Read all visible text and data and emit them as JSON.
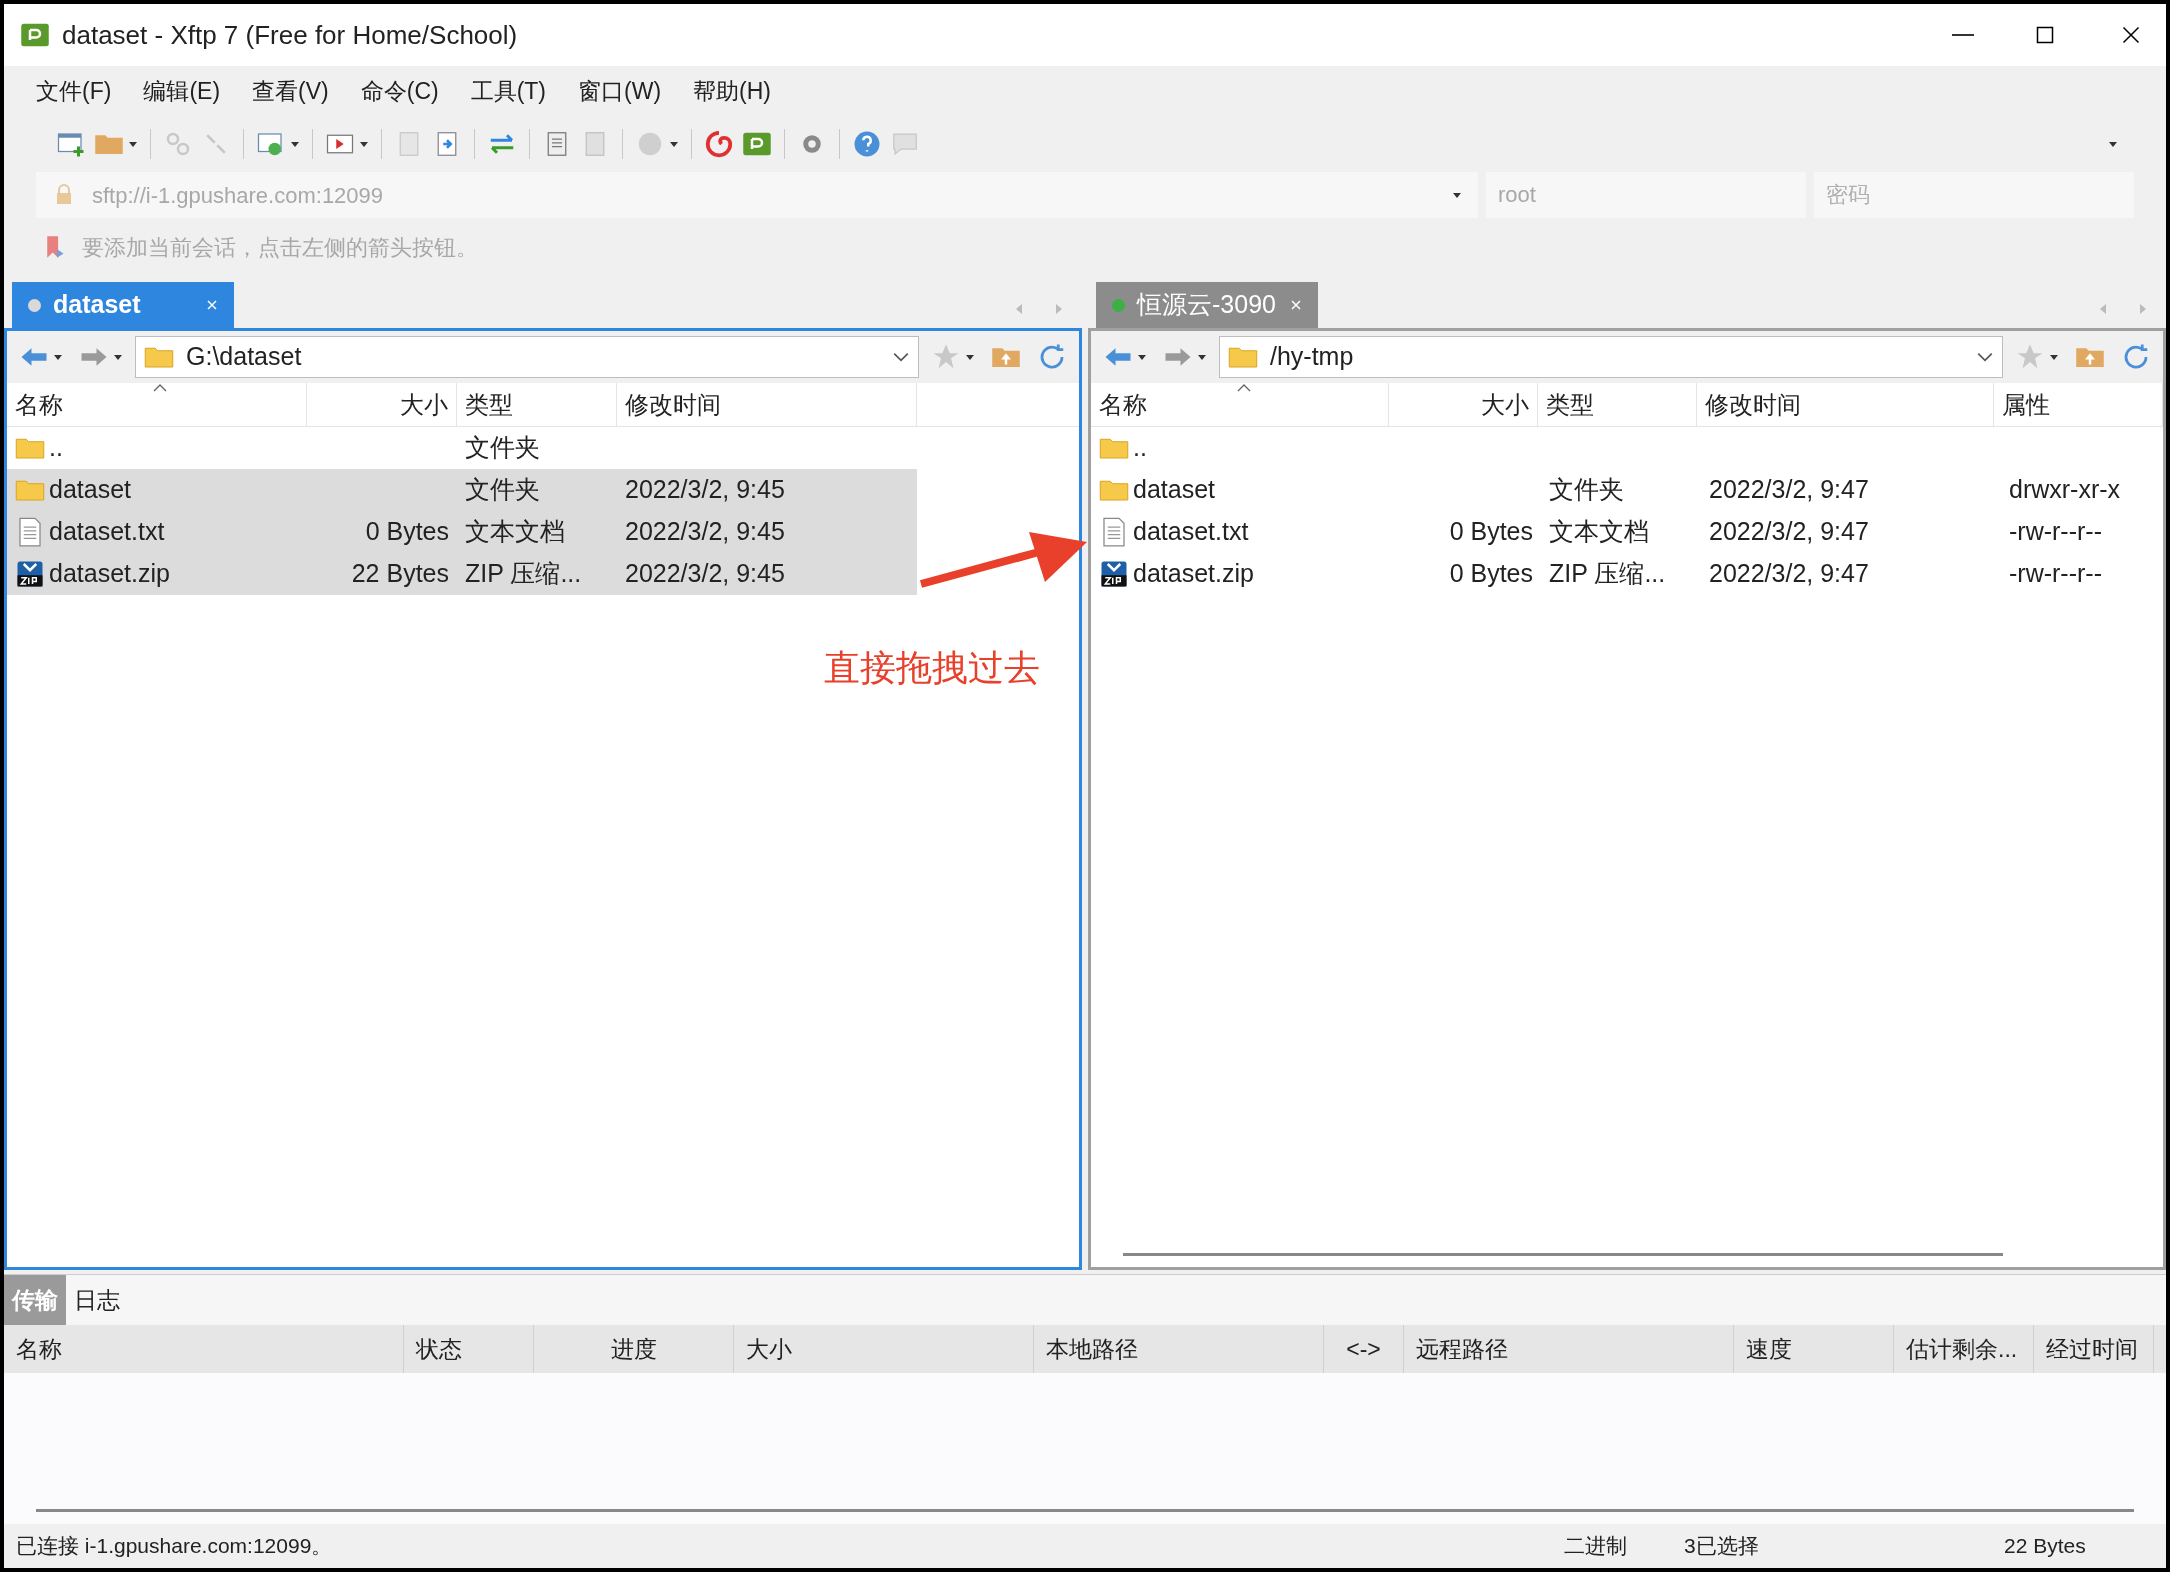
{
  "window": {
    "title": "dataset - Xftp 7 (Free for Home/School)"
  },
  "menu": [
    "文件(F)",
    "编辑(E)",
    "查看(V)",
    "命令(C)",
    "工具(T)",
    "窗口(W)",
    "帮助(H)"
  ],
  "address": {
    "url": "sftp://i-1.gpushare.com:12099",
    "user": "root",
    "password_placeholder": "密码"
  },
  "hint": "要添加当前会话，点击左侧的箭头按钮。",
  "panes": [
    {
      "tab": {
        "label": "dataset",
        "selected": true,
        "color": "#d9d9d9"
      },
      "path": "G:\\dataset",
      "columns": [
        "名称",
        "大小",
        "类型",
        "修改时间"
      ],
      "rows": [
        {
          "kind": "folder",
          "name": "..",
          "size": "",
          "type": "文件夹",
          "modified": "",
          "selected": false
        },
        {
          "kind": "folder",
          "name": "dataset",
          "size": "",
          "type": "文件夹",
          "modified": "2022/3/2, 9:45",
          "selected": true
        },
        {
          "kind": "text",
          "name": "dataset.txt",
          "size": "0 Bytes",
          "type": "文本文档",
          "modified": "2022/3/2, 9:45",
          "selected": true
        },
        {
          "kind": "zip",
          "name": "dataset.zip",
          "size": "22 Bytes",
          "type": "ZIP 压缩...",
          "modified": "2022/3/2, 9:45",
          "selected": true
        }
      ]
    },
    {
      "tab": {
        "label": "恒源云-3090",
        "selected": false,
        "color": "#3cb043"
      },
      "path": "/hy-tmp",
      "columns": [
        "名称",
        "大小",
        "类型",
        "修改时间",
        "属性"
      ],
      "rows": [
        {
          "kind": "folder",
          "name": "..",
          "size": "",
          "type": "",
          "modified": "",
          "attributes": "",
          "selected": false
        },
        {
          "kind": "folder",
          "name": "dataset",
          "size": "",
          "type": "文件夹",
          "modified": "2022/3/2, 9:47",
          "attributes": "drwxr-xr-x",
          "selected": false
        },
        {
          "kind": "text",
          "name": "dataset.txt",
          "size": "0 Bytes",
          "type": "文本文档",
          "modified": "2022/3/2, 9:47",
          "attributes": "-rw-r--r--",
          "selected": false
        },
        {
          "kind": "zip",
          "name": "dataset.zip",
          "size": "0 Bytes",
          "type": "ZIP 压缩...",
          "modified": "2022/3/2, 9:47",
          "attributes": "-rw-r--r--",
          "selected": false
        }
      ]
    }
  ],
  "annotation": "直接拖拽过去",
  "transfer": {
    "tabs": [
      {
        "label": "传输",
        "selected": true
      },
      {
        "label": "日志",
        "selected": false
      }
    ],
    "columns": [
      "名称",
      "状态",
      "进度",
      "大小",
      "本地路径",
      "<->",
      "远程路径",
      "速度",
      "估计剩余...",
      "经过时间"
    ]
  },
  "status_bar": {
    "connection": "已连接 i-1.gpushare.com:12099。",
    "mode": "二进制",
    "selection": "3已选择",
    "size": "22 Bytes"
  }
}
